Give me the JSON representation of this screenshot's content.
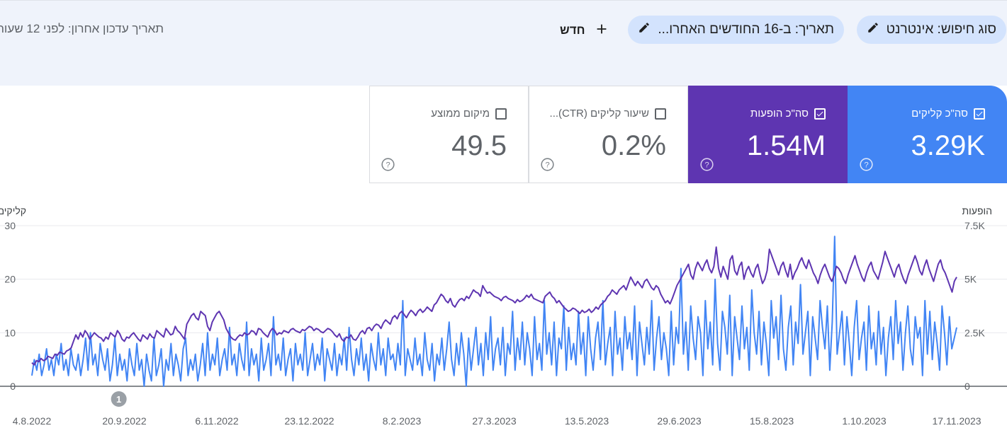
{
  "filters": {
    "search_type": "סוג חיפוש: אינטרנט",
    "date": "תאריך: ב-16 החודשים האחרו...",
    "new_label": "חדש",
    "last_updated": "תאריך עדכון אחרון: לפני 12 שעות"
  },
  "cards": [
    {
      "label": "סה\"כ קליקים",
      "value": "3.29K",
      "checked": true,
      "color": "#4285f4"
    },
    {
      "label": "סה\"כ הופעות",
      "value": "1.54M",
      "checked": true,
      "color": "#5e35b1"
    },
    {
      "label": "שיעור קליקים (CTR)...",
      "value": "0.2%",
      "checked": false
    },
    {
      "label": "מיקום ממוצע",
      "value": "49.5",
      "checked": false
    }
  ],
  "icons": {
    "edit": "pencil-icon",
    "add": "plus-icon",
    "help": "help-circle-icon",
    "check": "checkmark-icon"
  },
  "chart_data": {
    "type": "line",
    "left_axis": {
      "label": "קליקים",
      "ticks": [
        "30",
        "20",
        "10",
        "0"
      ],
      "range": [
        0,
        30
      ]
    },
    "right_axis": {
      "label": "הופעות",
      "ticks": [
        "7.5K",
        "5K",
        "2.5K",
        "0"
      ],
      "range": [
        0,
        7500
      ]
    },
    "x_tick_labels": [
      "4.8.2022",
      "20.9.2022",
      "6.11.2022",
      "23.12.2022",
      "8.2.2023",
      "27.3.2023",
      "13.5.2023",
      "29.6.2023",
      "15.8.2023",
      "1.10.2023",
      "17.11.2023"
    ],
    "x_start": "2022-08-04",
    "x_end": "2023-12-17",
    "annotation": {
      "label": "1",
      "date": "2022-09-20"
    },
    "grid": true,
    "series": [
      {
        "name": "קליקים",
        "axis": "left",
        "color": "#4285f4",
        "values": [
          2,
          5,
          3,
          6,
          2,
          4,
          7,
          3,
          5,
          2,
          6,
          4,
          8,
          3,
          5,
          2,
          7,
          4,
          3,
          6,
          2,
          5,
          9,
          3,
          10,
          4,
          6,
          2,
          8,
          5,
          3,
          7,
          1,
          4,
          9,
          2,
          6,
          3,
          5,
          1,
          7,
          4,
          2,
          8,
          3,
          5,
          0,
          6,
          3,
          1,
          9,
          2,
          4,
          7,
          0,
          5,
          3,
          8,
          2,
          6,
          4,
          1,
          7,
          9,
          2,
          5,
          3,
          6,
          1,
          4,
          8,
          2,
          10,
          3,
          6,
          4,
          9,
          2,
          5,
          7,
          3,
          11,
          4,
          6,
          2,
          8,
          5,
          3,
          12,
          2,
          7,
          4,
          6,
          1,
          9,
          3,
          5,
          8,
          2,
          13,
          4,
          6,
          3,
          9,
          2,
          5,
          7,
          1,
          8,
          4,
          6,
          3,
          10,
          2,
          5,
          8,
          3,
          6,
          4,
          9,
          1,
          7,
          5,
          3,
          8,
          2,
          6,
          4,
          9,
          3,
          11,
          5,
          2,
          7,
          4,
          9,
          3,
          6,
          1,
          8,
          5,
          3,
          10,
          4,
          7,
          2,
          9,
          5,
          6,
          3,
          8,
          4,
          16,
          2,
          7,
          5,
          3,
          9,
          4,
          6,
          2,
          10,
          5,
          3,
          8,
          1,
          6,
          4,
          9,
          3,
          7,
          12,
          5,
          2,
          8,
          4,
          10,
          6,
          0,
          9,
          3,
          7,
          11,
          4,
          8,
          2,
          10,
          5,
          13,
          3,
          7,
          9,
          4,
          11,
          2,
          8,
          6,
          14,
          3,
          9,
          5,
          12,
          4,
          10,
          7,
          2,
          13,
          5,
          8,
          3,
          16,
          6,
          10,
          4,
          12,
          2,
          9,
          7,
          15,
          3,
          11,
          5,
          8,
          4,
          14,
          6,
          10,
          2,
          13,
          7,
          3,
          9,
          12,
          5,
          16,
          4,
          8,
          11,
          2,
          14,
          6,
          9,
          3,
          13,
          7,
          10,
          5,
          15,
          2,
          12,
          8,
          4,
          11,
          6,
          16,
          3,
          9,
          13,
          5,
          10,
          7,
          2,
          14,
          4,
          11,
          8,
          22,
          6,
          12,
          3,
          15,
          9,
          5,
          13,
          10,
          2,
          16,
          7,
          12,
          4,
          20,
          8,
          3,
          14,
          11,
          6,
          17,
          2,
          13,
          9,
          5,
          15,
          7,
          11,
          3,
          18,
          10,
          6,
          14,
          4,
          12,
          8,
          2,
          16,
          9,
          13,
          5,
          17,
          7,
          3,
          11,
          15,
          4,
          12,
          8,
          19,
          6,
          10,
          14,
          2,
          13,
          9,
          5,
          16,
          11,
          7,
          15,
          3,
          12,
          28,
          6,
          10,
          14,
          4,
          13,
          8,
          2,
          11,
          16,
          5,
          9,
          12,
          3,
          15,
          7,
          10,
          4,
          14,
          6,
          11,
          2,
          9,
          13,
          5,
          16,
          8,
          12,
          3,
          10,
          15,
          7,
          4,
          13,
          9,
          11,
          2,
          16,
          6,
          14,
          5,
          12,
          8,
          3,
          15,
          10,
          4,
          13,
          7,
          9,
          11
        ]
      },
      {
        "name": "הופעות",
        "axis": "right",
        "color": "#5e35b1",
        "values": [
          1100,
          1000,
          1200,
          1150,
          1300,
          1200,
          1250,
          1400,
          1350,
          1300,
          1500,
          1450,
          1600,
          1550,
          1500,
          1650,
          1700,
          1800,
          2100,
          2400,
          2200,
          2500,
          2300,
          2600,
          2450,
          2200,
          2350,
          2500,
          2400,
          2300,
          2250,
          2100,
          2300,
          2200,
          2500,
          2400,
          2300,
          2600,
          2450,
          2200,
          2100,
          2300,
          2250,
          2400,
          2500,
          2350,
          2200,
          2100,
          2400,
          2300,
          2200,
          2450,
          2300,
          2250,
          2600,
          2500,
          2400,
          2300,
          2700,
          2550,
          2400,
          2450,
          2800,
          2600,
          2500,
          2350,
          2200,
          2900,
          3100,
          3300,
          3400,
          3200,
          3100,
          3500,
          3400,
          3300,
          2800,
          2600,
          3000,
          3200,
          3400,
          3500,
          3300,
          3100,
          2700,
          2500,
          2300,
          2200,
          2150,
          2300,
          2400,
          2350,
          2500,
          2400,
          2450,
          2600,
          2550,
          2400,
          2700,
          2650,
          2500,
          2400,
          2300,
          2550,
          2700,
          2600,
          2400,
          2500,
          2450,
          2600,
          2550,
          2500,
          2650,
          2700,
          2600,
          2550,
          2500,
          2650,
          2600,
          2700,
          2800,
          2750,
          2600,
          2700,
          2650,
          2550,
          2500,
          2600,
          2700,
          2650,
          2550,
          2400,
          2300,
          2450,
          2200,
          2100,
          2300,
          2250,
          2400,
          2200,
          2150,
          2300,
          2500,
          2600,
          2450,
          2700,
          2750,
          2600,
          2800,
          2900,
          2850,
          2700,
          2950,
          3100,
          3000,
          2900,
          3200,
          3300,
          3150,
          3400,
          3500,
          3350,
          3200,
          3400,
          3550,
          3450,
          3300,
          3500,
          3600,
          3450,
          3550,
          3700,
          3600,
          3500,
          3800,
          3900,
          4100,
          4300,
          4200,
          4000,
          3900,
          4100,
          3800,
          3700,
          3900,
          4050,
          4100,
          4000,
          4200,
          4100,
          4300,
          4500,
          4400,
          4350,
          4200,
          4700,
          4500,
          4350,
          4400,
          4300,
          4200,
          4150,
          4100,
          4000,
          4150,
          4200,
          4100,
          4050,
          4000,
          3900,
          4050,
          3950,
          4000,
          4100,
          4250,
          4150,
          4300,
          4100,
          4050,
          4000,
          3950,
          3900,
          4200,
          4300,
          4400,
          4200,
          4100,
          3900,
          4000,
          3850,
          3700,
          3600,
          3500,
          3550,
          3650,
          3600,
          3500,
          3400,
          3550,
          3450,
          3500,
          3600,
          3450,
          3550,
          3700,
          3600,
          3800,
          3900,
          4000,
          4200,
          4300,
          4500,
          4400,
          4300,
          4500,
          4600,
          4700,
          4500,
          4800,
          5100,
          4900,
          4700,
          4900,
          4750,
          4600,
          4900,
          5000,
          4800,
          4600,
          4500,
          4700,
          4600,
          4300,
          4100,
          3900,
          4000,
          3850,
          4100,
          4400,
          4700,
          4900,
          5100,
          5300,
          5500,
          5700,
          5200,
          5000,
          5500,
          5800,
          5600,
          5400,
          5700,
          5900,
          5500,
          5300,
          5600,
          6500,
          5500,
          5100,
          5600,
          5300,
          5000,
          5900,
          6100,
          5400,
          5200,
          5600,
          5800,
          5000,
          5400,
          5600,
          5300,
          5100,
          5500,
          5700,
          5200,
          4800,
          5000,
          5400,
          6400,
          6100,
          5800,
          5500,
          5200,
          5600,
          5800,
          5400,
          5100,
          5700,
          5000,
          5300,
          5500,
          5800,
          6000,
          5700,
          5500,
          5900,
          5600,
          5300,
          5100,
          4800,
          5200,
          5500,
          5700,
          5400,
          5100,
          4900,
          5200,
          5600,
          5500,
          5300,
          5000,
          4800,
          5200,
          5500,
          5800,
          6100,
          5700,
          5400,
          5100,
          4900,
          5300,
          5600,
          5800,
          5400,
          5200,
          5000,
          5400,
          5800,
          6300,
          6000,
          5700,
          5400,
          5100,
          5500,
          5700,
          5300,
          5000,
          4800,
          5200,
          5500,
          5800,
          6100,
          5800,
          5400,
          5200,
          5600,
          5900,
          5500,
          5200,
          4900,
          5300,
          5700,
          5900,
          5500,
          5300,
          5000,
          4700,
          4400,
          4900,
          5100
        ]
      }
    ]
  }
}
